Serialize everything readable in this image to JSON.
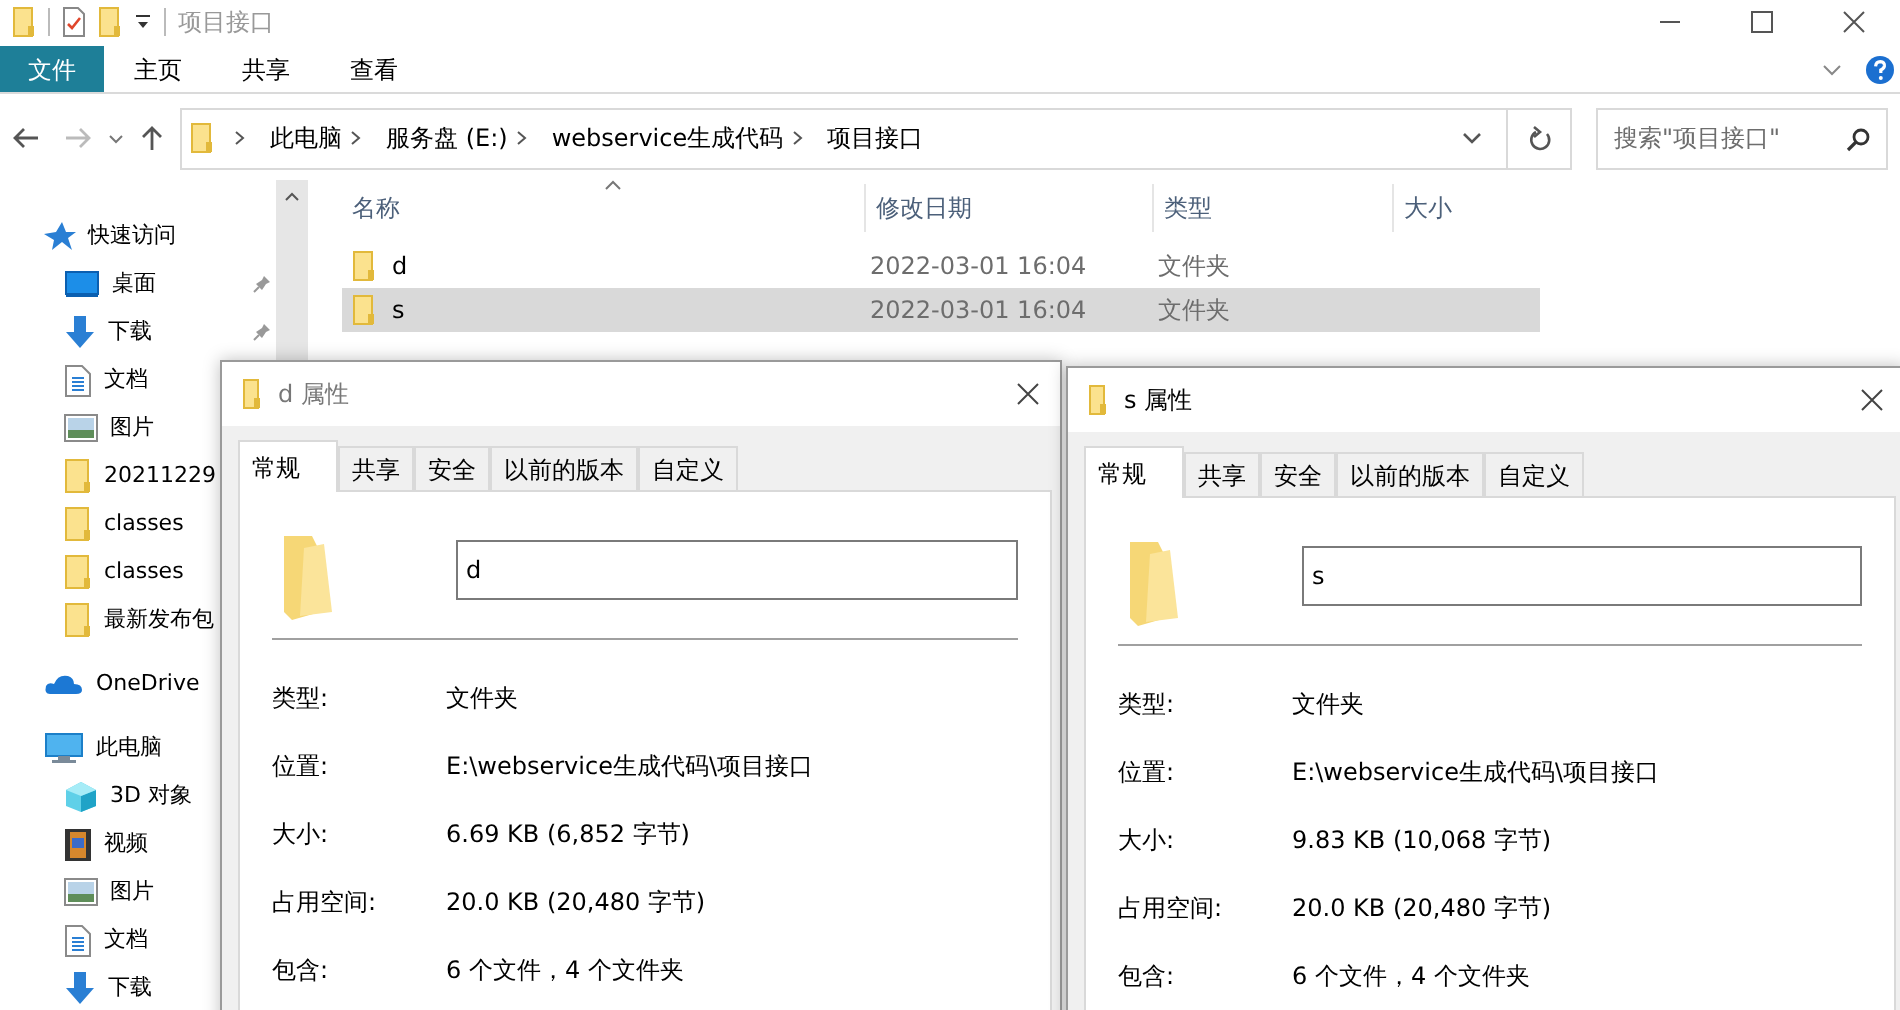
{
  "window": {
    "title": "项目接口"
  },
  "ribbon": {
    "tabs": [
      {
        "label": "文件",
        "kind": "file",
        "selected": false
      },
      {
        "label": "主页",
        "kind": "tab",
        "selected": false
      },
      {
        "label": "共享",
        "kind": "tab",
        "selected": false
      },
      {
        "label": "查看",
        "kind": "tab",
        "selected": false
      }
    ]
  },
  "address_bar": {
    "breadcrumbs": [
      "此电脑",
      "服务盘 (E:)",
      "webservice生成代码",
      "项目接口"
    ]
  },
  "search": {
    "placeholder": "搜索\"项目接口\""
  },
  "sidebar": {
    "items": [
      {
        "label": "快速访问",
        "kind": "star",
        "pinned": false,
        "children": [
          {
            "label": "桌面",
            "kind": "desktop",
            "pinned": true
          },
          {
            "label": "下载",
            "kind": "download",
            "pinned": true
          },
          {
            "label": "文档",
            "kind": "document"
          },
          {
            "label": "图片",
            "kind": "picture"
          },
          {
            "label": "20211229",
            "kind": "folder"
          },
          {
            "label": "classes",
            "kind": "folder"
          },
          {
            "label": "classes",
            "kind": "folder"
          },
          {
            "label": "最新发布包",
            "kind": "folder"
          }
        ]
      },
      {
        "label": "OneDrive",
        "kind": "cloud"
      },
      {
        "label": "此电脑",
        "kind": "pc",
        "children": [
          {
            "label": "3D 对象",
            "kind": "cube"
          },
          {
            "label": "视频",
            "kind": "video"
          },
          {
            "label": "图片",
            "kind": "picture"
          },
          {
            "label": "文档",
            "kind": "document"
          },
          {
            "label": "下载",
            "kind": "download"
          }
        ]
      }
    ]
  },
  "file_list": {
    "columns": [
      {
        "label": "名称",
        "sorted": true
      },
      {
        "label": "修改日期",
        "sorted": false
      },
      {
        "label": "类型",
        "sorted": false
      },
      {
        "label": "大小",
        "sorted": false
      }
    ],
    "rows": [
      {
        "name": "d",
        "modified": "2022-03-01 16:04",
        "type": "文件夹",
        "selected": false
      },
      {
        "name": "s",
        "modified": "2022-03-01 16:04",
        "type": "文件夹",
        "selected": true
      }
    ]
  },
  "dialogs": [
    {
      "title": "d 属性",
      "name": "d",
      "tabs": [
        {
          "label": "常规",
          "selected": true
        },
        {
          "label": "共享",
          "selected": false
        },
        {
          "label": "安全",
          "selected": false
        },
        {
          "label": "以前的版本",
          "selected": false
        },
        {
          "label": "自定义",
          "selected": false
        }
      ],
      "properties": [
        {
          "label": "类型:",
          "value": "文件夹"
        },
        {
          "label": "位置:",
          "value": "E:\\webservice生成代码\\项目接口"
        },
        {
          "label": "大小:",
          "value": "6.69 KB (6,852 字节)"
        },
        {
          "label": "占用空间:",
          "value": "20.0 KB (20,480 字节)"
        },
        {
          "label": "包含:",
          "value": "6 个文件，4 个文件夹"
        }
      ]
    },
    {
      "title": "s 属性",
      "name": "s",
      "tabs": [
        {
          "label": "常规",
          "selected": true
        },
        {
          "label": "共享",
          "selected": false
        },
        {
          "label": "安全",
          "selected": false
        },
        {
          "label": "以前的版本",
          "selected": false
        },
        {
          "label": "自定义",
          "selected": false
        }
      ],
      "properties": [
        {
          "label": "类型:",
          "value": "文件夹"
        },
        {
          "label": "位置:",
          "value": "E:\\webservice生成代码\\项目接口"
        },
        {
          "label": "大小:",
          "value": "9.83 KB (10,068 字节)"
        },
        {
          "label": "占用空间:",
          "value": "20.0 KB (20,480 字节)"
        },
        {
          "label": "包含:",
          "value": "6 个文件，4 个文件夹"
        }
      ]
    }
  ]
}
